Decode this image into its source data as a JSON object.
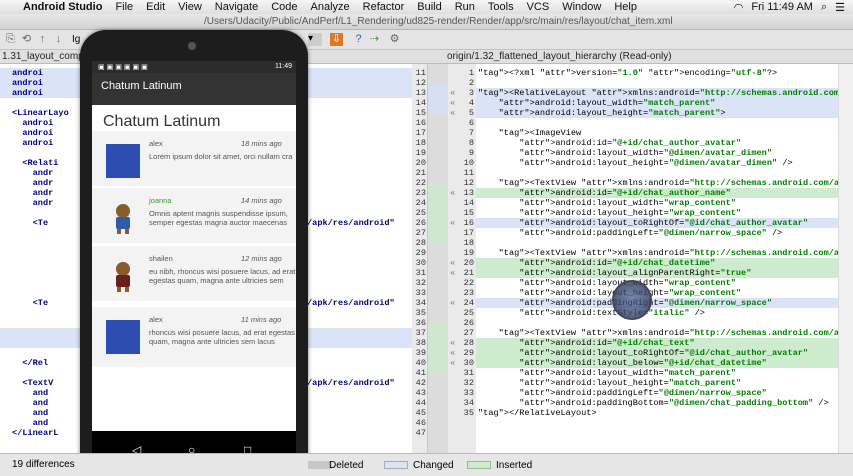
{
  "menubar": {
    "apple": "",
    "app": "Android Studio",
    "items": [
      "File",
      "Edit",
      "View",
      "Navigate",
      "Code",
      "Analyze",
      "Refactor",
      "Build",
      "Run",
      "Tools",
      "VCS",
      "Window",
      "Help"
    ],
    "clock": "Fri 11:49 AM"
  },
  "title": {
    "path": "/Users/Udacity/Public/AndPerf/L1_Rendering/ud825-render/Render/app/src/main/res/layout/chat_item.xml"
  },
  "toolbar": {
    "ignore_label": "Ig"
  },
  "filetabs": {
    "left": "1.31_layout_compa",
    "right": "origin/1.32_flattened_layout_hierarchy (Read-only)"
  },
  "left_code": [
    {
      "t": "androi",
      "c": "chg"
    },
    {
      "t": "androi",
      "c": "chg"
    },
    {
      "t": "androi",
      "c": "chg"
    },
    {
      "t": "",
      "c": ""
    },
    {
      "t": "<LinearLayo",
      "c": ""
    },
    {
      "t": "  androi",
      "c": ""
    },
    {
      "t": "  androi",
      "c": ""
    },
    {
      "t": "  androi",
      "c": ""
    },
    {
      "t": "",
      "c": ""
    },
    {
      "t": "  <Relati",
      "c": ""
    },
    {
      "t": "    andr",
      "c": ""
    },
    {
      "t": "    andr",
      "c": ""
    },
    {
      "t": "    andr",
      "c": ""
    },
    {
      "t": "    andr",
      "c": ""
    },
    {
      "t": "",
      "c": ""
    },
    {
      "t": "    <Te",
      "c": ""
    },
    {
      "t": "",
      "c": ""
    },
    {
      "t": "",
      "c": ""
    },
    {
      "t": "",
      "c": ""
    },
    {
      "t": "",
      "c": ""
    },
    {
      "t": "",
      "c": ""
    },
    {
      "t": "",
      "c": ""
    },
    {
      "t": "",
      "c": ""
    },
    {
      "t": "    <Te",
      "c": ""
    },
    {
      "t": "",
      "c": ""
    },
    {
      "t": "",
      "c": ""
    },
    {
      "t": "",
      "c": "chg"
    },
    {
      "t": "",
      "c": "chg"
    },
    {
      "t": "",
      "c": ""
    },
    {
      "t": "  </Rel",
      "c": ""
    },
    {
      "t": "",
      "c": ""
    },
    {
      "t": "  <TextV",
      "c": ""
    },
    {
      "t": "    and",
      "c": ""
    },
    {
      "t": "    and",
      "c": ""
    },
    {
      "t": "    and",
      "c": ""
    },
    {
      "t": "    and",
      "c": ""
    },
    {
      "t": "</LinearL",
      "c": ""
    }
  ],
  "left_tail": [
    {
      "row": 15,
      "text": "/apk/res/android\""
    },
    {
      "row": 23,
      "text": "/apk/res/android\""
    },
    {
      "row": 31,
      "text": "/apk/res/android\""
    }
  ],
  "left_nums": [
    "11",
    "12",
    "13",
    "14",
    "15",
    "16",
    "17",
    "18",
    "19",
    "20",
    "21",
    "22",
    "23",
    "24",
    "25",
    "26",
    "27",
    "28",
    "29",
    "30",
    "31",
    "32",
    "33",
    "34",
    "35",
    "36",
    "37",
    "38",
    "39",
    "40",
    "41",
    "42",
    "43",
    "44",
    "45",
    "46",
    "47"
  ],
  "right_nums": [
    "1",
    "2",
    "3",
    "4",
    "5",
    "6",
    "7",
    "8",
    "9",
    "10",
    "11",
    "12",
    "13",
    "14",
    "15",
    "16",
    "17",
    "18",
    "19",
    "20",
    "21",
    "22",
    "23",
    "24",
    "25",
    "26",
    "27",
    "28",
    "29",
    "30",
    "31",
    "32",
    "33",
    "34",
    "35"
  ],
  "right_code": [
    {
      "t": "<?xml version=\"1.0\" encoding=\"utf-8\"?>",
      "c": ""
    },
    {
      "t": "",
      "c": ""
    },
    {
      "t": "<RelativeLayout xmlns:android=\"http://schemas.android.com/apk/res/android\"",
      "c": "chg"
    },
    {
      "t": "    android:layout_width=\"match_parent\"",
      "c": "chg"
    },
    {
      "t": "    android:layout_height=\"match_parent\">",
      "c": "chg"
    },
    {
      "t": "",
      "c": ""
    },
    {
      "t": "    <ImageView",
      "c": ""
    },
    {
      "t": "        android:id=\"@+id/chat_author_avatar\"",
      "c": ""
    },
    {
      "t": "        android:layout_width=\"@dimen/avatar_dimen\"",
      "c": ""
    },
    {
      "t": "        android:layout_height=\"@dimen/avatar_dimen\" />",
      "c": ""
    },
    {
      "t": "",
      "c": ""
    },
    {
      "t": "    <TextView xmlns:android=\"http://schemas.android.com/apk/res/android\"",
      "c": ""
    },
    {
      "t": "        android:id=\"@+id/chat_author_name\"",
      "c": "ins"
    },
    {
      "t": "        android:layout_width=\"wrap_content\"",
      "c": ""
    },
    {
      "t": "        android:layout_height=\"wrap_content\"",
      "c": ""
    },
    {
      "t": "        android:layout_toRightOf=\"@id/chat_author_avatar\"",
      "c": "chg"
    },
    {
      "t": "        android:paddingLeft=\"@dimen/narrow_space\" />",
      "c": ""
    },
    {
      "t": "",
      "c": ""
    },
    {
      "t": "    <TextView xmlns:android=\"http://schemas.android.com/apk/res/android\"",
      "c": ""
    },
    {
      "t": "        android:id=\"@+id/chat_datetime\"",
      "c": "ins"
    },
    {
      "t": "        android:layout_alignParentRight=\"true\"",
      "c": "ins"
    },
    {
      "t": "        android:layout_width=\"wrap_content\"",
      "c": ""
    },
    {
      "t": "        android:layout_height=\"wrap_content\"",
      "c": ""
    },
    {
      "t": "        android:paddingRight=\"@dimen/narrow_space\"",
      "c": "chg"
    },
    {
      "t": "        android:textStyle=\"italic\" />",
      "c": ""
    },
    {
      "t": "",
      "c": ""
    },
    {
      "t": "    <TextView xmlns:android=\"http://schemas.android.com/apk/res/android\"",
      "c": ""
    },
    {
      "t": "        android:id=\"@+id/chat_text\"",
      "c": "ins"
    },
    {
      "t": "        android:layout_toRightOf=\"@id/chat_author_avatar\"",
      "c": "ins"
    },
    {
      "t": "        android:layout_below=\"@+id/chat_datetime\"",
      "c": "ins"
    },
    {
      "t": "        android:layout_width=\"match_parent\"",
      "c": ""
    },
    {
      "t": "        android:layout_height=\"match_parent\"",
      "c": ""
    },
    {
      "t": "        android:paddingLeft=\"@dimen/narrow_space\"",
      "c": ""
    },
    {
      "t": "        android:paddingBottom=\"@dimen/chat_padding_bottom\" />",
      "c": ""
    },
    {
      "t": "</RelativeLayout>",
      "c": ""
    }
  ],
  "phone": {
    "status_time": "11:49",
    "app_title": "Chatum Latinum",
    "big_title": "Chatum Latinum",
    "items": [
      {
        "name": "alex",
        "time": "18 mins ago",
        "text": "Lorem ipsum dolor sit amet, orci nullam cra",
        "avatar": "blue-square"
      },
      {
        "name": "joanna",
        "time": "14 mins ago",
        "text": "Omnis aptent magnis suspendisse ipsum, semper egestas magna auctor maecenas",
        "avatar": "android-girl"
      },
      {
        "name": "shailen",
        "time": "12 mins ago",
        "text": "eu nibh, rhoncus wisi posuere lacus, ad erat egestas quam, magna ante ultricies sem",
        "avatar": "android-boy"
      },
      {
        "name": "alex",
        "time": "11 mins ago",
        "text": "rhoncus wisi posuere lacus, ad erat egestas quam, magna ante ultricies sem lacus",
        "avatar": "blue-square"
      }
    ],
    "nav": [
      "◁",
      "○",
      "□"
    ]
  },
  "status": {
    "differences": "19 differences",
    "deleted": "Deleted",
    "changed": "Changed",
    "inserted": "Inserted"
  },
  "colors": {
    "inserted": "#cdeccd",
    "changed": "#dbe3f6",
    "deleted": "#c8c8c8",
    "avatar": "#2d4eb0"
  }
}
